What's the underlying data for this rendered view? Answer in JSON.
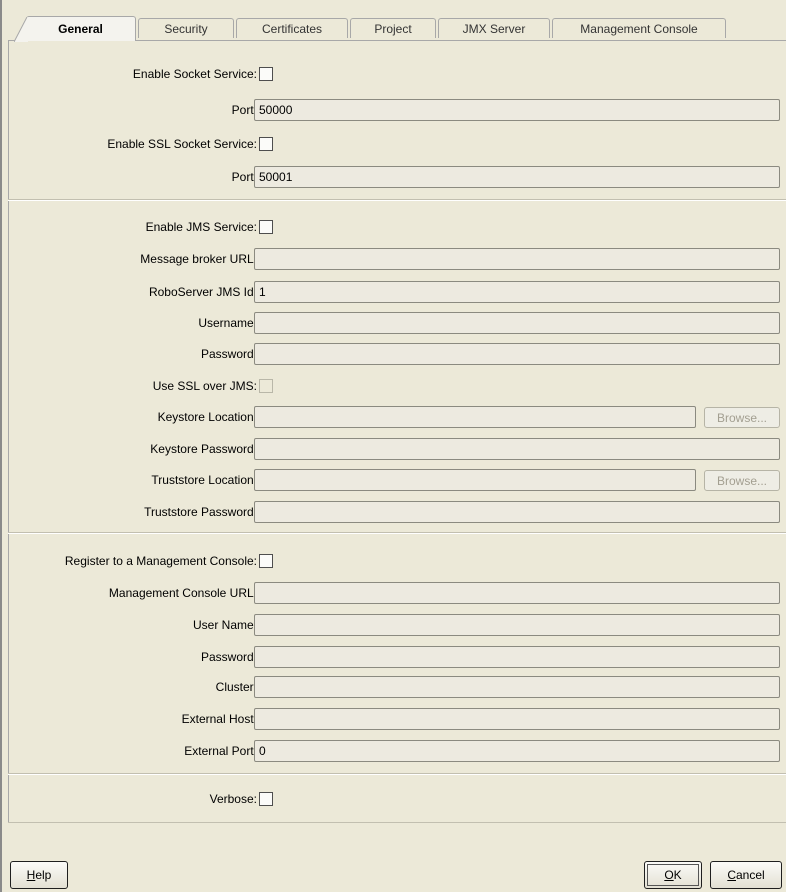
{
  "tabs": [
    {
      "label": "General",
      "active": true
    },
    {
      "label": "Security",
      "active": false
    },
    {
      "label": "Certificates",
      "active": false
    },
    {
      "label": "Project",
      "active": false
    },
    {
      "label": "JMX Server",
      "active": false
    },
    {
      "label": "Management Console",
      "active": false
    }
  ],
  "socket": {
    "enable_label": "Enable Socket Service:",
    "enabled": false,
    "port_label": "Port:",
    "port_value": "50000",
    "ssl_enable_label": "Enable SSL Socket Service:",
    "ssl_enabled": false,
    "ssl_port_label": "Port:",
    "ssl_port_value": "50001"
  },
  "jms": {
    "enable_label": "Enable JMS Service:",
    "enabled": false,
    "broker_url_label": "Message broker URL:",
    "broker_url_value": "",
    "jms_id_label": "RoboServer JMS Id:",
    "jms_id_value": "1",
    "username_label": "Username:",
    "username_value": "",
    "password_label": "Password:",
    "password_value": "",
    "ssl_label": "Use SSL over JMS:",
    "ssl_enabled": false,
    "keystore_location_label": "Keystore Location:",
    "keystore_location_value": "",
    "keystore_browse_label": "Browse...",
    "keystore_password_label": "Keystore Password:",
    "keystore_password_value": "",
    "truststore_location_label": "Truststore Location:",
    "truststore_location_value": "",
    "truststore_browse_label": "Browse...",
    "truststore_password_label": "Truststore Password:",
    "truststore_password_value": ""
  },
  "mc": {
    "register_label": "Register to a Management Console:",
    "registered": false,
    "url_label": "Management Console URL:",
    "url_value": "",
    "username_label": "User Name:",
    "username_value": "",
    "password_label": "Password:",
    "password_value": "",
    "cluster_label": "Cluster:",
    "cluster_value": "",
    "ext_host_label": "External Host:",
    "ext_host_value": "",
    "ext_port_label": "External Port:",
    "ext_port_value": "0"
  },
  "verbose": {
    "label": "Verbose:",
    "enabled": false
  },
  "buttons": {
    "help_mnemonic": "H",
    "help_rest": "elp",
    "ok_mnemonic": "O",
    "ok_rest": "K",
    "cancel_mnemonic": "C",
    "cancel_rest": "ancel"
  }
}
